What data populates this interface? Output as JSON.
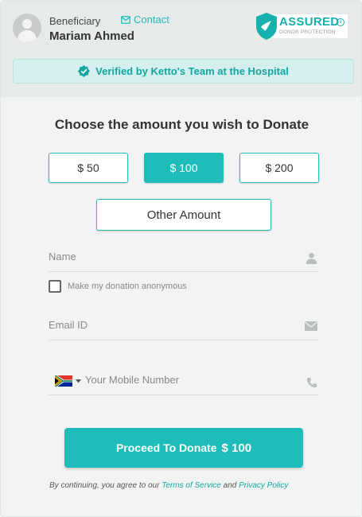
{
  "beneficiary": {
    "label": "Beneficiary",
    "name": "Mariam Ahmed",
    "contact_label": "Contact"
  },
  "badge": {
    "title": "ASSURED",
    "subtitle": "DONOR PROTECTION",
    "info": "i"
  },
  "verified_text": "Verified by Ketto's Team at the Hospital",
  "heading": "Choose the amount you wish to Donate",
  "amounts": [
    {
      "label": "$ 50",
      "selected": false
    },
    {
      "label": "$ 100",
      "selected": true
    },
    {
      "label": "$ 200",
      "selected": false
    }
  ],
  "other_amount": "Other Amount",
  "form": {
    "name_placeholder": "Name",
    "anonymous_label": "Make my donation anonymous",
    "email_placeholder": "Email ID",
    "mobile_placeholder": "Your Mobile Number"
  },
  "proceed": {
    "label": "Proceed To Donate",
    "amount": "$ 100"
  },
  "terms": {
    "prefix": "By continuing, you agree to our ",
    "tos": "Terms of Service",
    "and": " and ",
    "privacy": "Privacy Policy"
  },
  "colors": {
    "accent": "#1ebdb9",
    "header_bg": "#e6ebea",
    "verified_bg": "#d4efed"
  }
}
